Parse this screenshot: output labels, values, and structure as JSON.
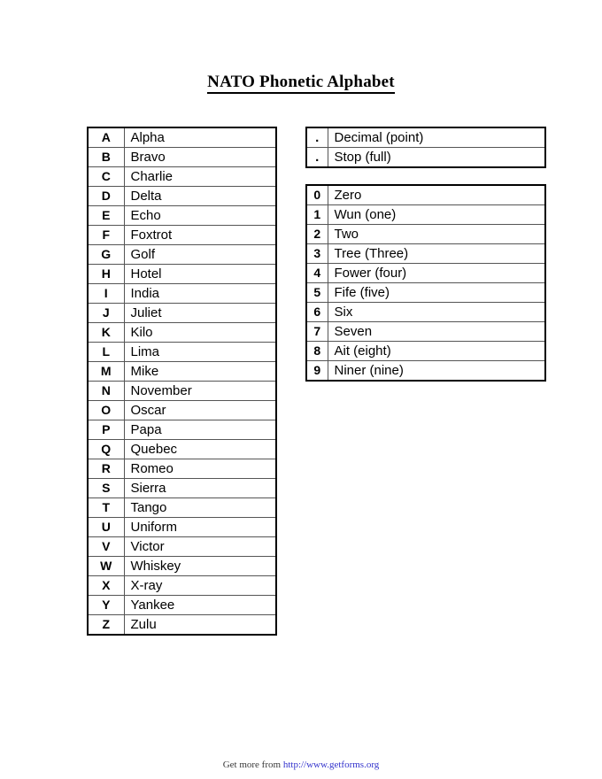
{
  "document": {
    "title": "NATO Phonetic Alphabet"
  },
  "alphabet_table": {
    "name": "alphabet-table",
    "rows": [
      {
        "symbol": "A",
        "word": "Alpha"
      },
      {
        "symbol": "B",
        "word": "Bravo"
      },
      {
        "symbol": "C",
        "word": "Charlie"
      },
      {
        "symbol": "D",
        "word": "Delta"
      },
      {
        "symbol": "E",
        "word": "Echo"
      },
      {
        "symbol": "F",
        "word": "Foxtrot"
      },
      {
        "symbol": "G",
        "word": "Golf"
      },
      {
        "symbol": "H",
        "word": "Hotel"
      },
      {
        "symbol": "I",
        "word": "India"
      },
      {
        "symbol": "J",
        "word": "Juliet"
      },
      {
        "symbol": "K",
        "word": "Kilo"
      },
      {
        "symbol": "L",
        "word": "Lima"
      },
      {
        "symbol": "M",
        "word": "Mike"
      },
      {
        "symbol": "N",
        "word": "November"
      },
      {
        "symbol": "O",
        "word": "Oscar"
      },
      {
        "symbol": "P",
        "word": "Papa"
      },
      {
        "symbol": "Q",
        "word": "Quebec"
      },
      {
        "symbol": "R",
        "word": "Romeo"
      },
      {
        "symbol": "S",
        "word": "Sierra"
      },
      {
        "symbol": "T",
        "word": "Tango"
      },
      {
        "symbol": "U",
        "word": "Uniform"
      },
      {
        "symbol": "V",
        "word": "Victor"
      },
      {
        "symbol": "W",
        "word": "Whiskey"
      },
      {
        "symbol": "X",
        "word": "X-ray"
      },
      {
        "symbol": "Y",
        "word": "Yankee"
      },
      {
        "symbol": "Z",
        "word": "Zulu"
      }
    ]
  },
  "punctuation_table": {
    "name": "punctuation-table",
    "rows": [
      {
        "symbol": ".",
        "word": "Decimal (point)"
      },
      {
        "symbol": ".",
        "word": "Stop (full)"
      }
    ]
  },
  "numbers_table": {
    "name": "numbers-table",
    "rows": [
      {
        "symbol": "0",
        "word": "Zero"
      },
      {
        "symbol": "1",
        "word": "Wun (one)"
      },
      {
        "symbol": "2",
        "word": "Two"
      },
      {
        "symbol": "3",
        "word": "Tree (Three)"
      },
      {
        "symbol": "4",
        "word": "Fower (four)"
      },
      {
        "symbol": "5",
        "word": "Fife (five)"
      },
      {
        "symbol": "6",
        "word": "Six"
      },
      {
        "symbol": "7",
        "word": "Seven"
      },
      {
        "symbol": "8",
        "word": "Ait (eight)"
      },
      {
        "symbol": "9",
        "word": "Niner (nine)"
      }
    ]
  },
  "footer": {
    "prefix": "Get more from ",
    "link_text": "http://www.getforms.org",
    "link_color": "#3333cc"
  }
}
